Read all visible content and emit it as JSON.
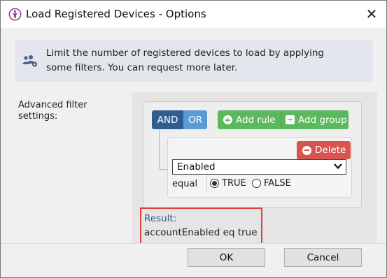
{
  "window": {
    "title": "Load Registered Devices - Options",
    "close_glyph": "✕"
  },
  "info": {
    "text": "Limit the number of registered devices to load by applying some filters. You can request more later.",
    "icon": "users-cog-icon"
  },
  "filter": {
    "label": "Advanced filter settings:",
    "conditions": {
      "and_label": "AND",
      "or_label": "OR",
      "selected": "AND"
    },
    "add_rule_label": "Add rule",
    "add_group_label": "Add group",
    "rule": {
      "delete_label": "Delete",
      "field_value": "Enabled",
      "operator": "equal",
      "options": [
        {
          "label": "TRUE",
          "checked": true
        },
        {
          "label": "FALSE",
          "checked": false
        }
      ]
    }
  },
  "result": {
    "label": "Result:",
    "value": "accountEnabled eq true"
  },
  "buttons": {
    "ok": "OK",
    "cancel": "Cancel"
  },
  "colors": {
    "and_active": "#2f5d90",
    "or_inactive": "#5b9bd5",
    "add_green": "#5cb85c",
    "delete_red": "#d9534f",
    "result_highlight": "#e04040"
  }
}
